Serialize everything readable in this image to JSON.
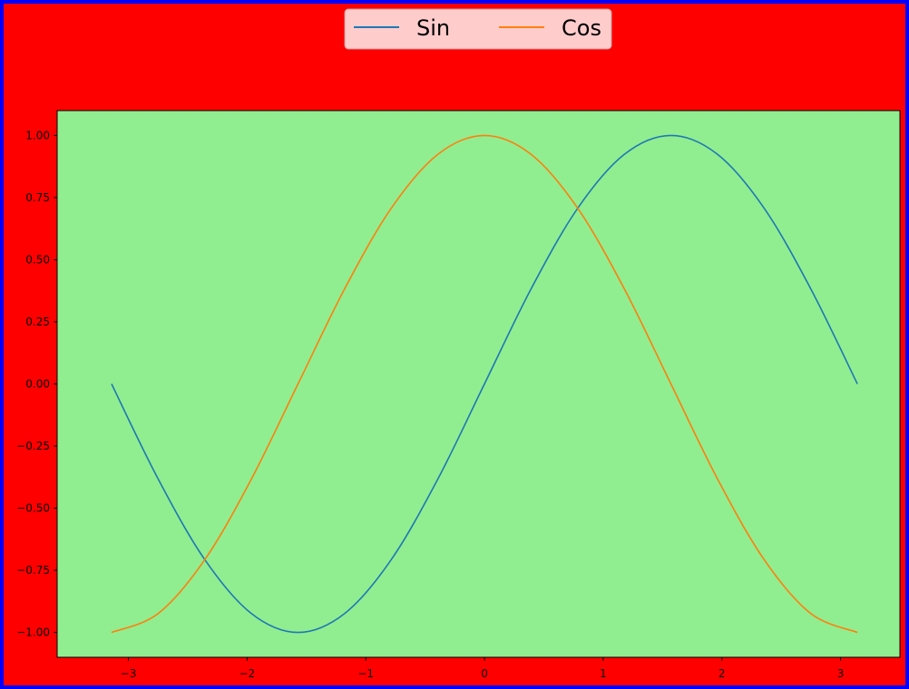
{
  "colors": {
    "figure_border": "#0000ff",
    "figure_background": "#ff0000",
    "axes_background": "#90ee90",
    "legend_background": "#ffcccc"
  },
  "chart_data": {
    "type": "line",
    "xlim": [
      -3.6,
      3.5
    ],
    "ylim": [
      -1.1,
      1.1
    ],
    "x_ticks": [
      -3,
      -2,
      -1,
      0,
      1,
      2,
      3
    ],
    "x_tick_labels": [
      "−3",
      "−2",
      "−1",
      "0",
      "1",
      "2",
      "3"
    ],
    "y_ticks": [
      1.0,
      0.75,
      0.5,
      0.25,
      0.0,
      -0.25,
      -0.5,
      -0.75,
      -1.0
    ],
    "y_tick_labels": [
      "1.00",
      "0.75",
      "0.50",
      "0.25",
      "0.00",
      "−0.25",
      "−0.50",
      "−0.75",
      "−1.00"
    ],
    "grid": false,
    "legend": {
      "placement": "top-center",
      "columns": 2
    },
    "series": [
      {
        "name": "Sin",
        "color": "#1f77b4",
        "x": [
          -3.1416,
          -2.7489,
          -2.3562,
          -1.9635,
          -1.5708,
          -1.1781,
          -0.7854,
          -0.3927,
          0,
          0.3927,
          0.7854,
          1.1781,
          1.5708,
          1.9635,
          2.3562,
          2.7489,
          3.1416
        ],
        "y": [
          0.0,
          -0.3827,
          -0.7071,
          -0.9239,
          -1.0,
          -0.9239,
          -0.7071,
          -0.3827,
          0.0,
          0.3827,
          0.7071,
          0.9239,
          1.0,
          0.9239,
          0.7071,
          0.3827,
          0.0
        ]
      },
      {
        "name": "Cos",
        "color": "#ff7f0e",
        "x": [
          -3.1416,
          -2.7489,
          -2.3562,
          -1.9635,
          -1.5708,
          -1.1781,
          -0.7854,
          -0.3927,
          0,
          0.3927,
          0.7854,
          1.1781,
          1.5708,
          1.9635,
          2.3562,
          2.7489,
          3.1416
        ],
        "y": [
          -1.0,
          -0.9239,
          -0.7071,
          -0.3827,
          0.0,
          0.3827,
          0.7071,
          0.9239,
          1.0,
          0.9239,
          0.7071,
          0.3827,
          0.0,
          -0.3827,
          -0.7071,
          -0.9239,
          -1.0
        ]
      }
    ]
  }
}
